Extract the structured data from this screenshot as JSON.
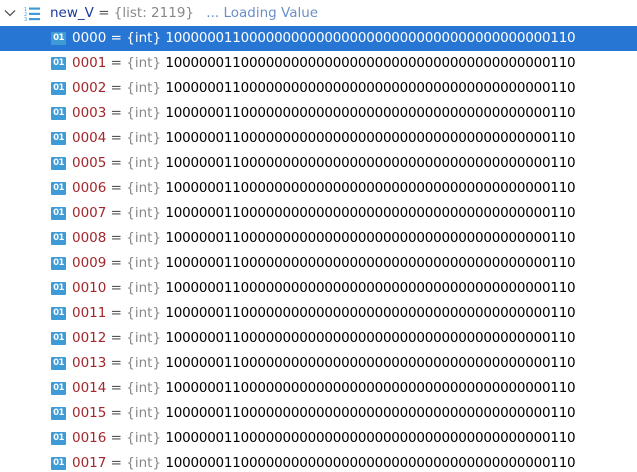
{
  "variable": {
    "name": "new_V",
    "equals": "=",
    "type_label": "{list: 2119}",
    "status": "... Loading Value",
    "expand_icon": "chevron-down-icon",
    "type_icon": "list-icon"
  },
  "items": [
    {
      "index": "0000",
      "type": "{int}",
      "value": "1000000110000000000000000000000000000000000000110",
      "selected": true
    },
    {
      "index": "0001",
      "type": "{int}",
      "value": "1000000110000000000000000000000000000000000000110"
    },
    {
      "index": "0002",
      "type": "{int}",
      "value": "1000000110000000000000000000000000000000000000110"
    },
    {
      "index": "0003",
      "type": "{int}",
      "value": "1000000110000000000000000000000000000000000000110"
    },
    {
      "index": "0004",
      "type": "{int}",
      "value": "1000000110000000000000000000000000000000000000110"
    },
    {
      "index": "0005",
      "type": "{int}",
      "value": "1000000110000000000000000000000000000000000000110"
    },
    {
      "index": "0006",
      "type": "{int}",
      "value": "1000000110000000000000000000000000000000000000110"
    },
    {
      "index": "0007",
      "type": "{int}",
      "value": "1000000110000000000000000000000000000000000000110"
    },
    {
      "index": "0008",
      "type": "{int}",
      "value": "1000000110000000000000000000000000000000000000110"
    },
    {
      "index": "0009",
      "type": "{int}",
      "value": "1000000110000000000000000000000000000000000000110"
    },
    {
      "index": "0010",
      "type": "{int}",
      "value": "1000000110000000000000000000000000000000000000110"
    },
    {
      "index": "0011",
      "type": "{int}",
      "value": "1000000110000000000000000000000000000000000000110"
    },
    {
      "index": "0012",
      "type": "{int}",
      "value": "1000000110000000000000000000000000000000000000110"
    },
    {
      "index": "0013",
      "type": "{int}",
      "value": "1000000110000000000000000000000000000000000000110"
    },
    {
      "index": "0014",
      "type": "{int}",
      "value": "1000000110000000000000000000000000000000000000110"
    },
    {
      "index": "0015",
      "type": "{int}",
      "value": "1000000110000000000000000000000000000000000000110"
    },
    {
      "index": "0016",
      "type": "{int}",
      "value": "1000000110000000000000000000000000000000000000110"
    },
    {
      "index": "0017",
      "type": "{int}",
      "value": "1000000110000000000000000000000000000000000000110"
    }
  ],
  "item_icon_label": "01",
  "colors": {
    "selection": "#2876d4",
    "index": "#a3262b",
    "variable_name": "#1a3a9a",
    "loading": "#6b8fc7",
    "int_icon": "#3f9bd6"
  }
}
